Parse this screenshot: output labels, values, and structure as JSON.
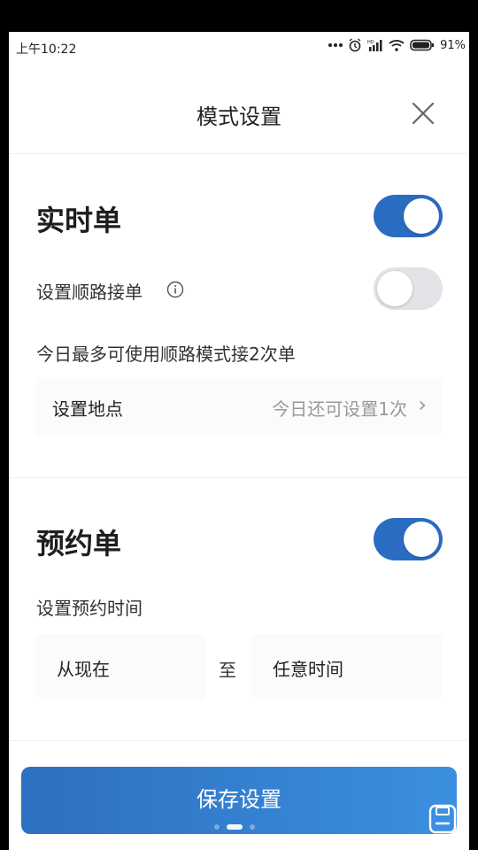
{
  "status_bar": {
    "time": "上午10:22",
    "battery": "91%"
  },
  "header": {
    "title": "模式设置"
  },
  "realtime": {
    "title": "实时单",
    "toggle_on": true,
    "route_label": "设置顺路接单",
    "route_toggle_on": false,
    "note": "今日最多可使用顺路模式接2次单",
    "location_label": "设置地点",
    "location_value": "今日还可设置1次",
    "chevron": "›"
  },
  "reservation": {
    "title": "预约单",
    "toggle_on": true,
    "time_label": "设置预约时间",
    "from": "从现在",
    "to_text": "至",
    "until": "任意时间"
  },
  "footer": {
    "save_label": "保存设置"
  },
  "colors": {
    "accent": "#2a6cc1",
    "toggle_off": "#e2e3e6"
  }
}
